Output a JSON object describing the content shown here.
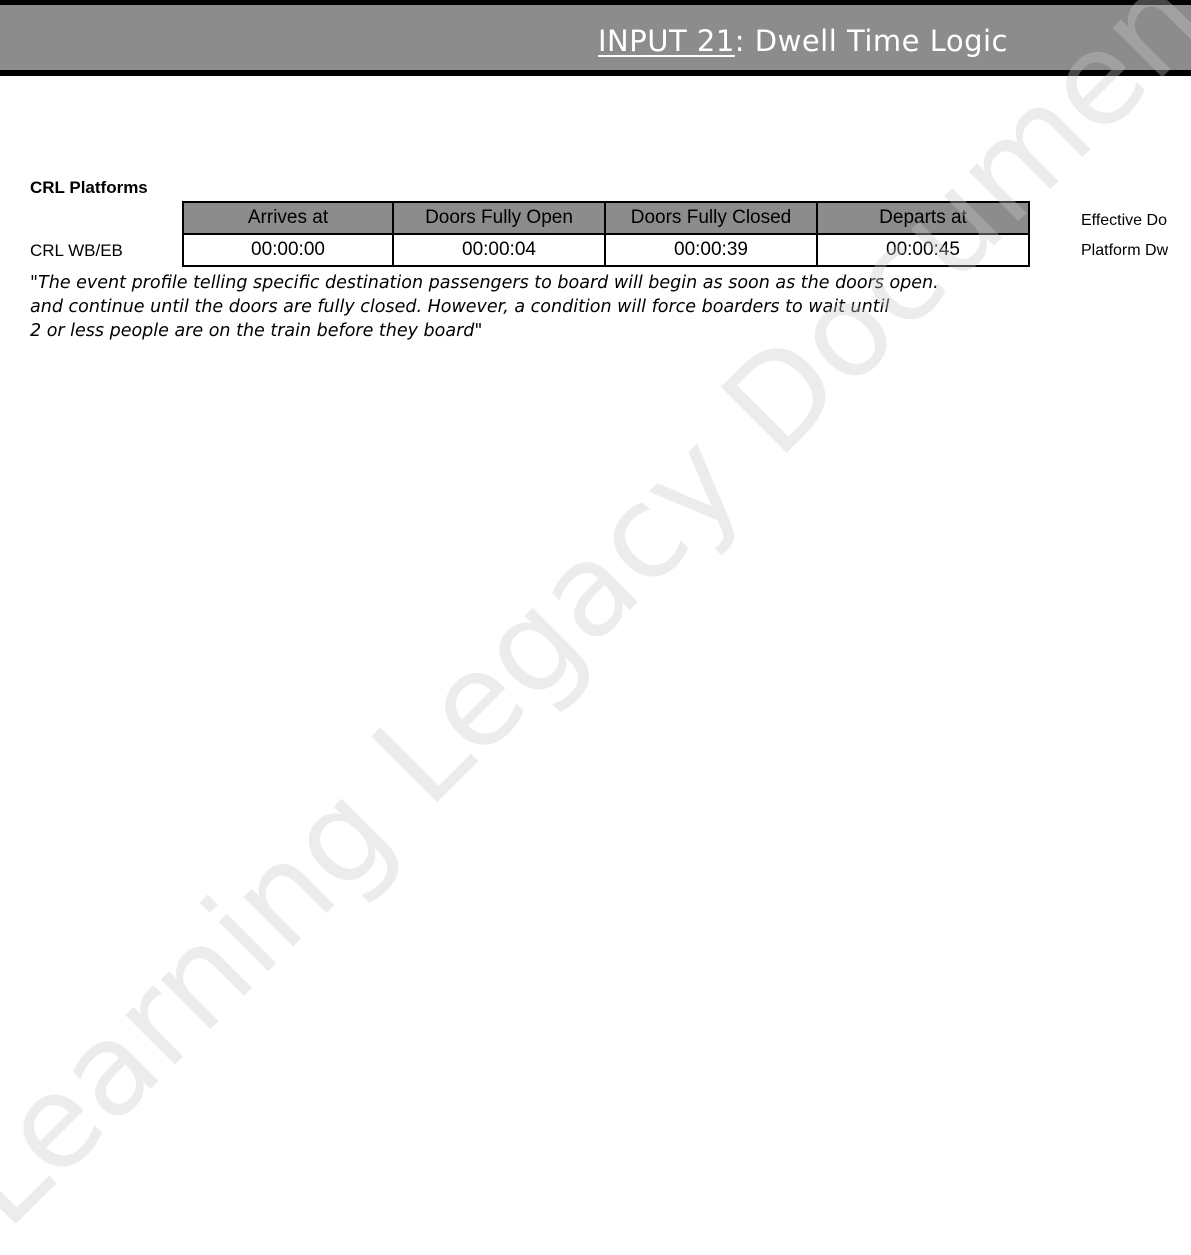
{
  "header": {
    "title_prefix": "INPUT 21",
    "title_suffix": ": Dwell Time Logic"
  },
  "section": {
    "title": "CRL Platforms",
    "row_label": "CRL WB/EB"
  },
  "table": {
    "headers": [
      "Arrives at",
      "Doors Fully Open",
      "Doors Fully Closed",
      "Departs at"
    ],
    "values": [
      "00:00:00",
      "00:00:04",
      "00:00:39",
      "00:00:45"
    ]
  },
  "side_labels": [
    "Effective Do",
    "Platform Dw"
  ],
  "quote": {
    "lines": [
      "\"The event profile telling specific destination passengers to board will begin as soon as the doors open.",
      "and continue until the doors are fully closed. However, a condition will force boarders to wait until",
      "2 or less people are on the train before they board\""
    ]
  },
  "watermark": "Learning Legacy Document",
  "colors": {
    "header_bg": "#8c8c8c",
    "header_border": "#000000",
    "table_header_bg": "#8c8c8c"
  }
}
